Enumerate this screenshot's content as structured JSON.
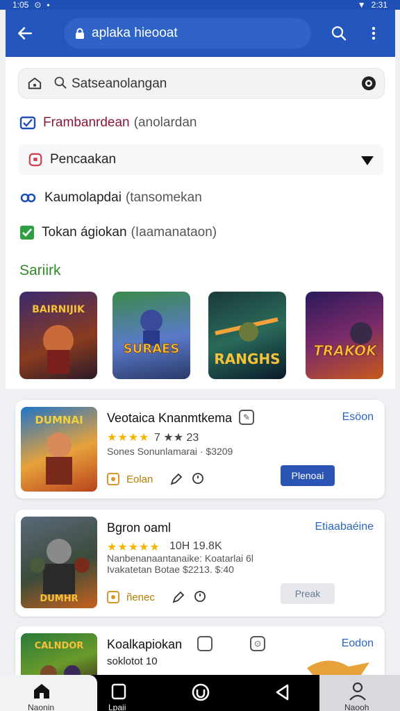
{
  "status_bar": {
    "time": "1:05",
    "battery": "2:31"
  },
  "app_bar": {
    "url_text": "aplaka hieooat"
  },
  "search": {
    "query": "Satseanolangan"
  },
  "menu_rows": {
    "row1": {
      "main": "Frambanrdean",
      "sub": "(anolardan"
    },
    "dropdown": {
      "label": "Pencaakan"
    },
    "row3": {
      "main": "Kaumolapdai",
      "sub": "(tansomekan"
    },
    "row4": {
      "main": "Tokan ágiokan",
      "sub": "(Iaamanataon)"
    }
  },
  "section": {
    "title": "Sariirk"
  },
  "featured_tiles": [
    {
      "label": "BAIRNIJIK"
    },
    {
      "label": "SURAES"
    },
    {
      "label": "RANGHS"
    },
    {
      "label": "TRAKOK"
    }
  ],
  "apps": [
    {
      "title": "Veotaica Knanmtkema",
      "right_link": "Esöon",
      "rating_text": "7 ★★ 23",
      "meta1": "Sones Sonunlamarai · $3209",
      "badge": "Eolan",
      "action": "Plenoai",
      "thumb_label": "DUMNAI"
    },
    {
      "title": "Bgron oaml",
      "right_link": "Etiaabaéine",
      "rating_text": "10H 19.8K",
      "meta1": "Nanbenanaantanaike:  Koatarlai 6l",
      "meta2": "Ivakatetan Botae      $2213.     $:40",
      "badge": "ñenec",
      "action": "Preak",
      "thumb_label": "DUMHR"
    },
    {
      "title": "Koalkapiokan",
      "right_link": "Eodon",
      "rating_text": "soklotot 10",
      "thumb_label": "CALNDOR"
    }
  ],
  "bottom_nav": {
    "home_label": "Naonin",
    "tab2_label": "Lpaii",
    "profile_label": "Naooh"
  },
  "colors": {
    "app_bar": "#2456be",
    "accent_link": "#2b63c9",
    "section_green": "#2f8a2a",
    "star": "#f4b400"
  }
}
